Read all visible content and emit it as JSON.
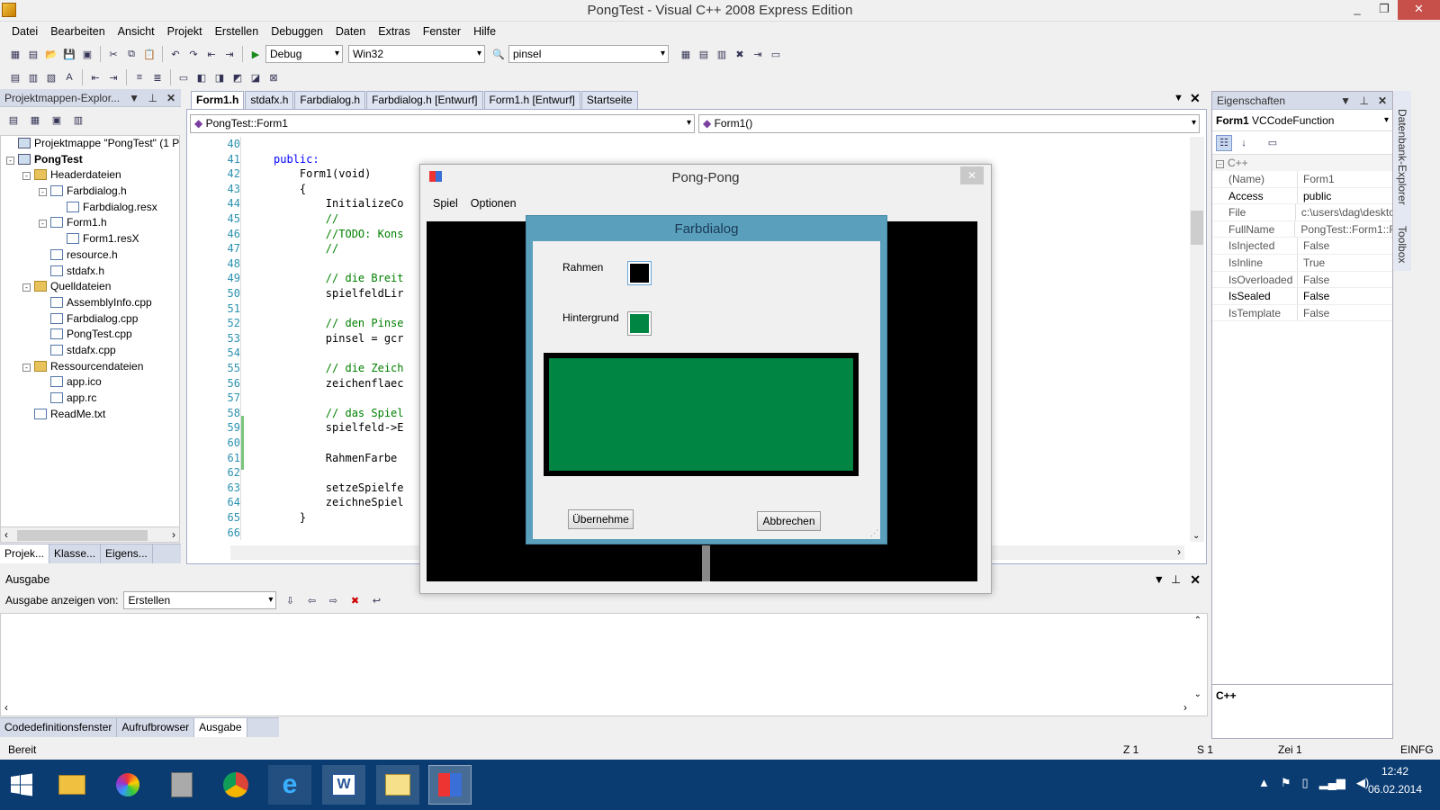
{
  "window": {
    "title": "PongTest - Visual C++ 2008 Express Edition",
    "minimize": "_",
    "maximize": "❐",
    "close": "✕"
  },
  "menu": [
    "Datei",
    "Bearbeiten",
    "Ansicht",
    "Projekt",
    "Erstellen",
    "Debuggen",
    "Daten",
    "Extras",
    "Fenster",
    "Hilfe"
  ],
  "toolbar": {
    "config": "Debug",
    "platform": "Win32",
    "find": "pinsel"
  },
  "solution_explorer": {
    "title": "Projektmappen-Explor...",
    "items": [
      {
        "label": "Projektmappe \"PongTest\" (1 Pro",
        "level": 0,
        "kind": "sol",
        "exp": ""
      },
      {
        "label": "PongTest",
        "level": 0,
        "kind": "proj",
        "exp": "-",
        "bold": true
      },
      {
        "label": "Headerdateien",
        "level": 1,
        "kind": "folder",
        "exp": "-"
      },
      {
        "label": "Farbdialog.h",
        "level": 2,
        "kind": "file",
        "exp": "-"
      },
      {
        "label": "Farbdialog.resx",
        "level": 3,
        "kind": "file",
        "exp": ""
      },
      {
        "label": "Form1.h",
        "level": 2,
        "kind": "file",
        "exp": "-"
      },
      {
        "label": "Form1.resX",
        "level": 3,
        "kind": "file",
        "exp": ""
      },
      {
        "label": "resource.h",
        "level": 2,
        "kind": "file",
        "exp": ""
      },
      {
        "label": "stdafx.h",
        "level": 2,
        "kind": "file",
        "exp": ""
      },
      {
        "label": "Quelldateien",
        "level": 1,
        "kind": "folder",
        "exp": "-"
      },
      {
        "label": "AssemblyInfo.cpp",
        "level": 2,
        "kind": "file",
        "exp": ""
      },
      {
        "label": "Farbdialog.cpp",
        "level": 2,
        "kind": "file",
        "exp": ""
      },
      {
        "label": "PongTest.cpp",
        "level": 2,
        "kind": "file",
        "exp": ""
      },
      {
        "label": "stdafx.cpp",
        "level": 2,
        "kind": "file",
        "exp": ""
      },
      {
        "label": "Ressourcendateien",
        "level": 1,
        "kind": "folder",
        "exp": "-"
      },
      {
        "label": "app.ico",
        "level": 2,
        "kind": "file",
        "exp": ""
      },
      {
        "label": "app.rc",
        "level": 2,
        "kind": "file",
        "exp": ""
      },
      {
        "label": "ReadMe.txt",
        "level": 1,
        "kind": "file",
        "exp": ""
      }
    ],
    "tabs": [
      "Projek...",
      "Klasse...",
      "Eigens..."
    ]
  },
  "editor": {
    "tabs": [
      "Form1.h",
      "stdafx.h",
      "Farbdialog.h",
      "Farbdialog.h [Entwurf]",
      "Form1.h [Entwurf]",
      "Startseite"
    ],
    "class_combo": "PongTest::Form1",
    "member_combo": "Form1()",
    "lines": [
      {
        "n": "40",
        "t": "",
        "c": ""
      },
      {
        "n": "41",
        "t": "public:",
        "c": "kw"
      },
      {
        "n": "42",
        "t": "    Form1(void)",
        "c": ""
      },
      {
        "n": "43",
        "t": "    {",
        "c": ""
      },
      {
        "n": "44",
        "t": "        InitializeCo",
        "c": ""
      },
      {
        "n": "45",
        "t": "        //",
        "c": "cm"
      },
      {
        "n": "46",
        "t": "        //TODO: Kons",
        "c": "cm"
      },
      {
        "n": "47",
        "t": "        //",
        "c": "cm"
      },
      {
        "n": "48",
        "t": "",
        "c": ""
      },
      {
        "n": "49",
        "t": "        // die Breit",
        "c": "cm"
      },
      {
        "n": "50",
        "t": "        spielfeldLir",
        "c": ""
      },
      {
        "n": "51",
        "t": "",
        "c": ""
      },
      {
        "n": "52",
        "t": "        // den Pinse",
        "c": "cm"
      },
      {
        "n": "53",
        "t": "        pinsel = gcr",
        "c": ""
      },
      {
        "n": "54",
        "t": "",
        "c": ""
      },
      {
        "n": "55",
        "t": "        // die Zeich",
        "c": "cm"
      },
      {
        "n": "56",
        "t": "        zeichenflaec",
        "c": ""
      },
      {
        "n": "57",
        "t": "",
        "c": ""
      },
      {
        "n": "58",
        "t": "        // das Spiel",
        "c": "cm"
      },
      {
        "n": "59",
        "t": "        spielfeld->E",
        "c": ""
      },
      {
        "n": "60",
        "t": "",
        "c": ""
      },
      {
        "n": "61",
        "t": "        RahmenFarbe",
        "c": ""
      },
      {
        "n": "62",
        "t": "",
        "c": ""
      },
      {
        "n": "63",
        "t": "        setzeSpielfe",
        "c": ""
      },
      {
        "n": "64",
        "t": "        zeichneSpiel",
        "c": ""
      },
      {
        "n": "65",
        "t": "    }",
        "c": ""
      },
      {
        "n": "66",
        "t": "",
        "c": ""
      }
    ]
  },
  "properties": {
    "title": "Eigenschaften",
    "object": "Form1",
    "object_type": "VCCodeFunction",
    "category": "C++",
    "rows": [
      {
        "k": "(Name)",
        "v": "Form1",
        "bold": false
      },
      {
        "k": "Access",
        "v": "public",
        "bold": true
      },
      {
        "k": "File",
        "v": "c:\\users\\dag\\deskto",
        "bold": false
      },
      {
        "k": "FullName",
        "v": "PongTest::Form1::F",
        "bold": false
      },
      {
        "k": "IsInjected",
        "v": "False",
        "bold": false
      },
      {
        "k": "IsInline",
        "v": "True",
        "bold": false
      },
      {
        "k": "IsOverloaded",
        "v": "False",
        "bold": false
      },
      {
        "k": "IsSealed",
        "v": "False",
        "bold": true
      },
      {
        "k": "IsTemplate",
        "v": "False",
        "bold": false
      }
    ],
    "description": "C++"
  },
  "side_tabs": [
    "Datenbank-Explorer",
    "Toolbox"
  ],
  "output": {
    "title": "Ausgabe",
    "show_label": "Ausgabe anzeigen von:",
    "source": "Erstellen",
    "tabs": [
      "Codedefinitionsfenster",
      "Aufrufbrowser",
      "Ausgabe"
    ]
  },
  "status": {
    "text": "Bereit",
    "line": "Z 1",
    "col": "S 1",
    "char": "Zei 1",
    "mode": "EINFG"
  },
  "pong": {
    "title": "Pong-Pong",
    "menu": [
      "Spiel",
      "Optionen"
    ],
    "close": "✕"
  },
  "farbdialog": {
    "title": "Farbdialog",
    "rahmen_label": "Rahmen",
    "hintergrund_label": "Hintergrund",
    "ok_button": "Übernehme",
    "cancel_button": "Abbrechen",
    "rahmen_color": "#000000",
    "hintergrund_color": "#008542"
  },
  "clock": {
    "time": "12:42",
    "date": "06.02.2014"
  }
}
